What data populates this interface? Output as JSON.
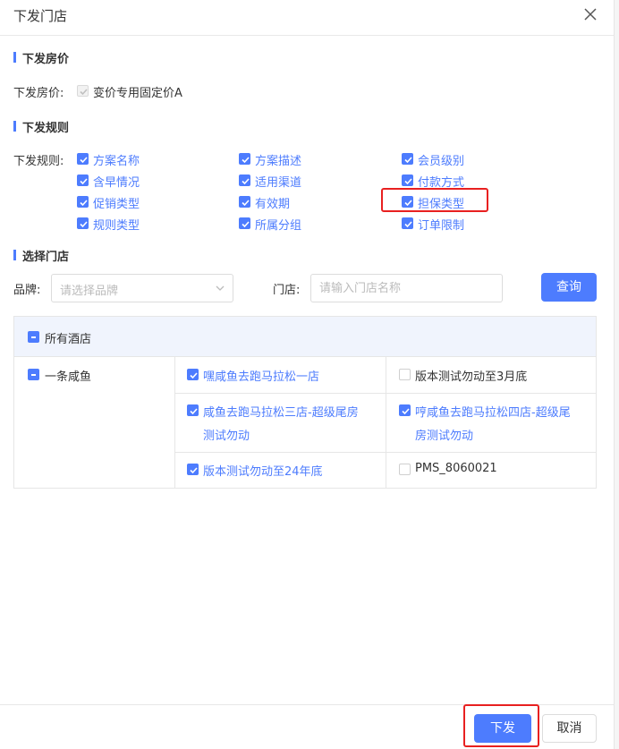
{
  "dialog": {
    "title": "下发门店",
    "close_icon": "close-icon"
  },
  "price_section": {
    "title": "下发房价",
    "label": "下发房价:",
    "option": "变价专用固定价A",
    "option_checked": true,
    "option_disabled": true
  },
  "rules_section": {
    "title": "下发规则",
    "label": "下发规则:",
    "options": [
      {
        "label": "方案名称",
        "checked": true
      },
      {
        "label": "方案描述",
        "checked": true
      },
      {
        "label": "会员级别",
        "checked": true
      },
      {
        "label": "含早情况",
        "checked": true
      },
      {
        "label": "适用渠道",
        "checked": true
      },
      {
        "label": "付款方式",
        "checked": true
      },
      {
        "label": "促销类型",
        "checked": true
      },
      {
        "label": "有效期",
        "checked": true
      },
      {
        "label": "担保类型",
        "checked": true
      },
      {
        "label": "规则类型",
        "checked": true
      },
      {
        "label": "所属分组",
        "checked": true
      },
      {
        "label": "订单限制",
        "checked": true
      }
    ]
  },
  "store_section": {
    "title": "选择门店",
    "brand_label": "品牌:",
    "brand_placeholder": "请选择品牌",
    "store_label": "门店:",
    "store_placeholder": "请输入门店名称",
    "query_button": "查询"
  },
  "hotel_table": {
    "all_label": "所有酒店",
    "group": "一条咸鱼",
    "stores": [
      {
        "line1": "嘿咸鱼去跑马拉松一店",
        "line2": "",
        "checked": true
      },
      {
        "line1": "版本测试勿动至3月底",
        "line2": "",
        "checked": false
      },
      {
        "line1": "咸鱼去跑马拉松三店-超级尾房",
        "line2": "测试勿动",
        "checked": true
      },
      {
        "line1": "哼咸鱼去跑马拉松四店-超级尾",
        "line2": "房测试勿动",
        "checked": true
      },
      {
        "line1": "版本测试勿动至24年底",
        "line2": "",
        "checked": true
      },
      {
        "line1": "PMS_8060021",
        "line2": "",
        "checked": false
      }
    ]
  },
  "footer": {
    "submit_button": "下发",
    "cancel_button": "取消"
  },
  "colors": {
    "accent": "#4d7cfe",
    "highlight": "#e82020"
  }
}
